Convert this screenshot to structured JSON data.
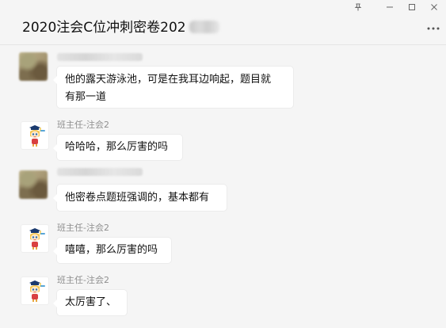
{
  "window": {
    "title": "2020注会C位冲刺密卷202",
    "title_blurred_suffix": true,
    "controls": {
      "pin": "pin-icon",
      "minimize": "minimize-icon",
      "maximize": "maximize-icon",
      "close": "close-icon",
      "more": "more-icon"
    }
  },
  "messages": [
    {
      "sender": "",
      "sender_blurred": true,
      "avatar": "blurred-avatar",
      "text_lines": [
        "他的露天游泳池，可是在我耳边响起，题目就",
        "有那一道"
      ]
    },
    {
      "sender": "班主任-注会2",
      "sender_blurred": false,
      "avatar": "mascot-avatar",
      "text_lines": [
        "哈哈哈，那么厉害的吗"
      ]
    },
    {
      "sender": "",
      "sender_blurred": true,
      "avatar": "blurred-avatar",
      "text_lines": [
        "他密卷点题班强调的，基本都有"
      ]
    },
    {
      "sender": "班主任-注会2",
      "sender_blurred": false,
      "avatar": "mascot-avatar",
      "text_lines": [
        "嘻嘻，那么厉害的吗"
      ]
    },
    {
      "sender": "班主任-注会2",
      "sender_blurred": false,
      "avatar": "mascot-avatar",
      "text_lines": [
        "太厉害了、"
      ]
    }
  ],
  "colors": {
    "background": "#f5f5f5",
    "bubble": "#ffffff",
    "sender_name": "#8f8f8f",
    "text": "#111111"
  }
}
